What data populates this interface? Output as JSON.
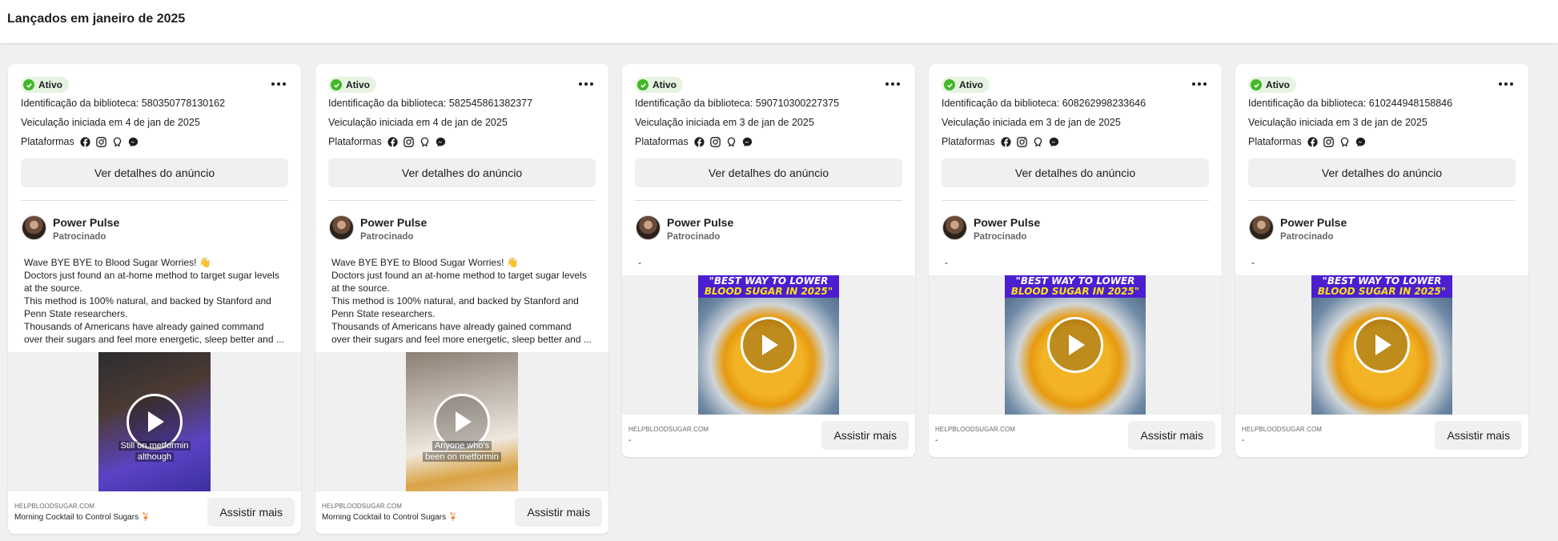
{
  "header": {
    "title": "Lançados em janeiro de 2025"
  },
  "labels": {
    "platforms": "Plataformas",
    "details_button": "Ver detalhes do anúncio",
    "cta_button": "Assistir mais",
    "sponsored": "Patrocinado"
  },
  "colors": {
    "active_green": "#42b72a",
    "active_bg": "#e7f3e1",
    "banner_purple": "#4b1fd0",
    "banner_yellow": "#ffe018"
  },
  "platform_icons": [
    "facebook-icon",
    "instagram-icon",
    "audience-network-icon",
    "messenger-icon"
  ],
  "ads": [
    {
      "status": "Ativo",
      "library_id": "Identificação da biblioteca: 580350778130162",
      "started": "Veiculação iniciada em 4 de jan de 2025",
      "page_name": "Power Pulse",
      "body": [
        "Wave BYE BYE to Blood Sugar Worries! 👋",
        "Doctors just found an at-home method to target sugar levels",
        "at the source.",
        "This method is 100% natural, and backed by Stanford and",
        "Penn State researchers.",
        "Thousands of Americans have already gained command",
        "over their sugars and feel more energetic, sleep better and ..."
      ],
      "video_caption_1": "Still on metformin",
      "video_caption_2": "although",
      "cta_domain": "HELPBLOODSUGAR.COM",
      "cta_title": "Morning Cocktail to Control Sugars 🍹"
    },
    {
      "status": "Ativo",
      "library_id": "Identificação da biblioteca: 582545861382377",
      "started": "Veiculação iniciada em 4 de jan de 2025",
      "page_name": "Power Pulse",
      "body": [
        "Wave BYE BYE to Blood Sugar Worries! 👋",
        "Doctors just found an at-home method to target sugar levels",
        "at the source.",
        "This method is 100% natural, and backed by Stanford and",
        "Penn State researchers.",
        "Thousands of Americans have already gained command",
        "over their sugars and feel more energetic, sleep better and ..."
      ],
      "video_caption_1": "Anyone who's",
      "video_caption_2": "been on metformin",
      "cta_domain": "HELPBLOODSUGAR.COM",
      "cta_title": "Morning Cocktail to Control Sugars 🍹"
    },
    {
      "status": "Ativo",
      "library_id": "Identificação da biblioteca: 590710300227375",
      "started": "Veiculação iniciada em 3 de jan de 2025",
      "page_name": "Power Pulse",
      "body_dash": "-",
      "banner_1": "\"BEST WAY TO LOWER",
      "banner_2": "BLOOD SUGAR IN 2025\"",
      "cta_domain": "HELPBLOODSUGAR.COM",
      "cta_title": "-"
    },
    {
      "status": "Ativo",
      "library_id": "Identificação da biblioteca: 608262998233646",
      "started": "Veiculação iniciada em 3 de jan de 2025",
      "page_name": "Power Pulse",
      "body_dash": "-",
      "banner_1": "\"BEST WAY TO LOWER",
      "banner_2": "BLOOD SUGAR IN 2025\"",
      "cta_domain": "HELPBLOODSUGAR.COM",
      "cta_title": "-"
    },
    {
      "status": "Ativo",
      "library_id": "Identificação da biblioteca: 610244948158846",
      "started": "Veiculação iniciada em 3 de jan de 2025",
      "page_name": "Power Pulse",
      "body_dash": "-",
      "banner_1": "\"BEST WAY TO LOWER",
      "banner_2": "BLOOD SUGAR IN 2025\"",
      "cta_domain": "HELPBLOODSUGAR.COM",
      "cta_title": "-"
    }
  ]
}
